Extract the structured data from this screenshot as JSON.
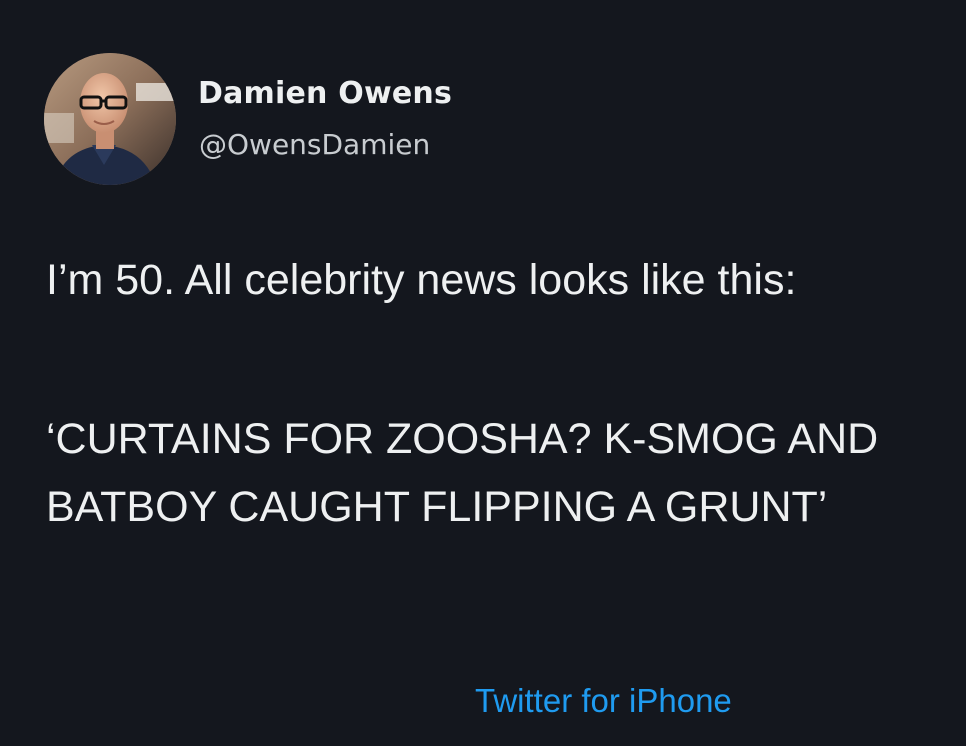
{
  "user": {
    "display_name": "Damien Owens",
    "handle": "@OwensDamien"
  },
  "tweet": {
    "paragraphs": [
      "I’m 50. All celebrity news looks like this:",
      "‘CURTAINS FOR ZOOSHA? K-SMOG AND BATBOY CAUGHT FLIPPING A GRUNT’"
    ],
    "source": "Twitter for iPhone"
  },
  "colors": {
    "background": "#14171e",
    "text": "#eef0f1",
    "handle": "#c8ccd0",
    "link": "#1f9bf0"
  },
  "icons": {
    "avatar": "profile-photo"
  }
}
